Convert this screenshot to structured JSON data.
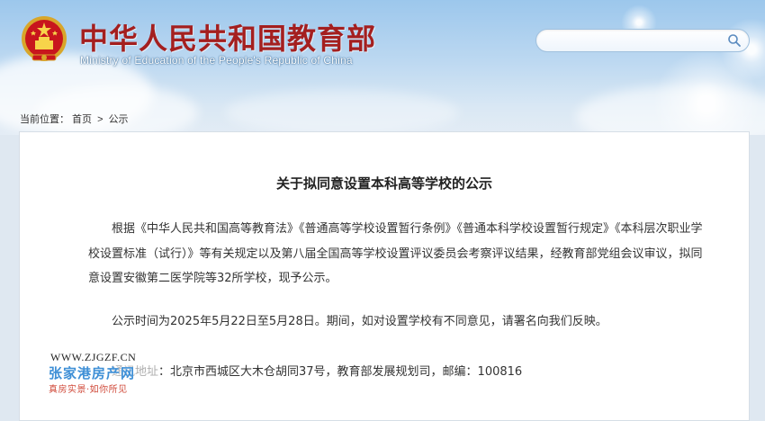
{
  "header": {
    "site_title": "中华人民共和国教育部",
    "site_subtitle": "Ministry of Education of the People's Republic of China",
    "emblem_icon": "national-emblem-icon",
    "search": {
      "value": "",
      "placeholder": "",
      "icon": "search-icon"
    },
    "title_color": "#a41f1f"
  },
  "breadcrumb": {
    "prefix": "当前位置：",
    "items": [
      "首页",
      "公示"
    ],
    "separator": ">"
  },
  "article": {
    "title": "关于拟同意设置本科高等学校的公示",
    "paragraphs": [
      "根据《中华人民共和国高等教育法》《普通高等学校设置暂行条例》《普通本科学校设置暂行规定》《本科层次职业学校设置标准（试行）》等有关规定以及第八届全国高等学校设置评议委员会考察评议结果，经教育部党组会议审议，拟同意设置安徽第二医学院等32所学校，现予公示。",
      "公示时间为2025年5月22日至5月28日。期间，如对设置学校有不同意见，请署名向我们反映。",
      "通讯地址：北京市西城区大木仓胡同37号，教育部发展规划司，邮编：100816"
    ]
  },
  "watermark": {
    "url": "WWW.ZJGZF.CN",
    "brand": "张家港房产网",
    "slogan": "真房实景·如你所见"
  }
}
